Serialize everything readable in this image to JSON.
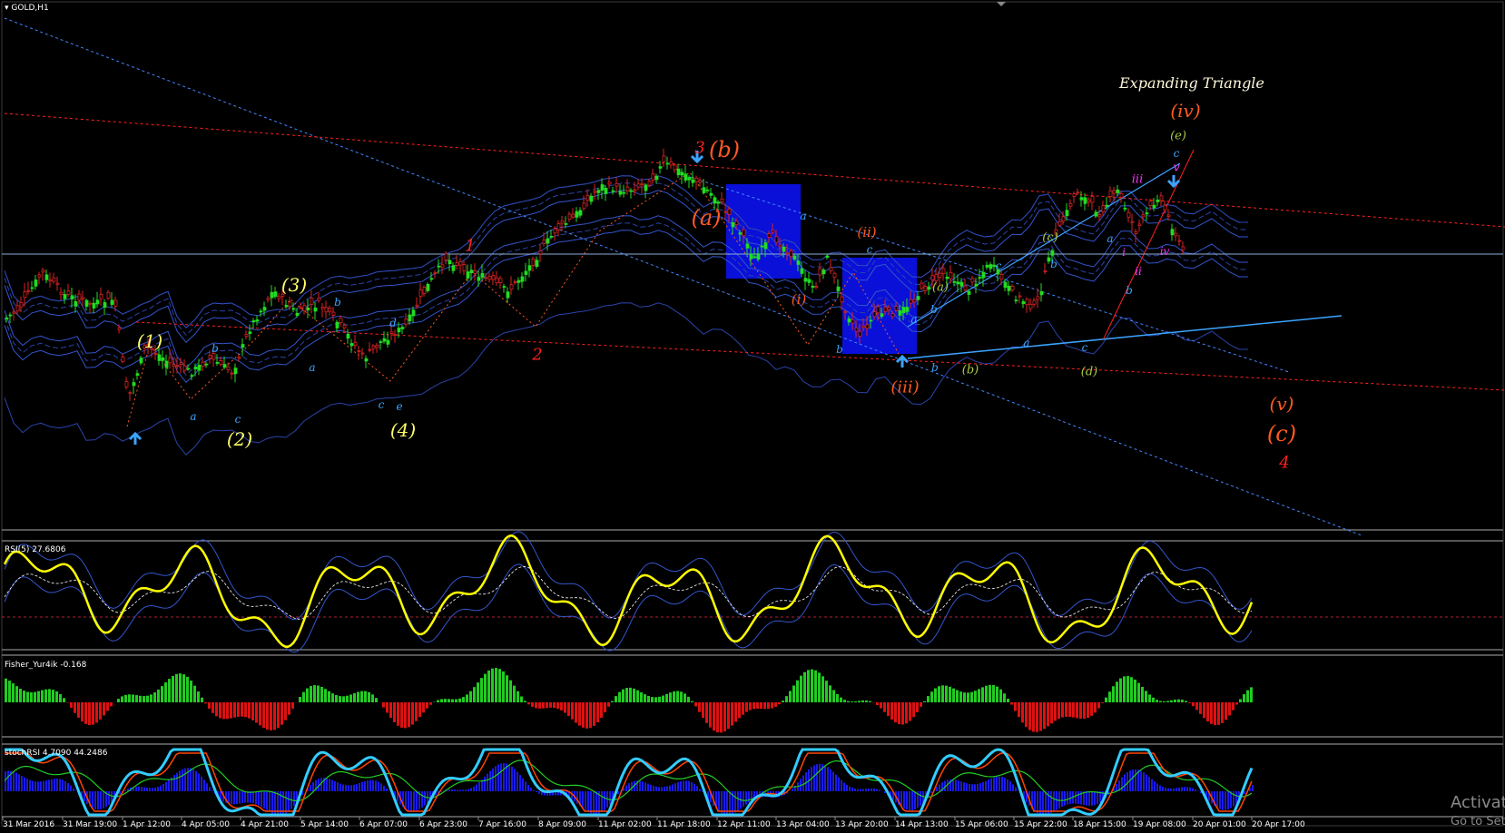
{
  "chart_data": [
    {
      "panel": "price",
      "type": "candlestick",
      "label": "GOLD,H1",
      "annotation_title": "Expanding Triangle",
      "x_labels": [
        "31 Mar 2016",
        "31 Mar 19:00",
        "1 Apr 12:00",
        "4 Apr 05:00",
        "4 Apr 21:00",
        "5 Apr 14:00",
        "6 Apr 07:00",
        "6 Apr 23:00",
        "7 Apr 16:00",
        "8 Apr 09:00",
        "11 Apr 02:00",
        "11 Apr 18:00",
        "12 Apr 11:00",
        "13 Apr 04:00",
        "13 Apr 20:00",
        "14 Apr 13:00",
        "15 Apr 06:00",
        "15 Apr 22:00",
        "18 Apr 15:00",
        "19 Apr 08:00",
        "20 Apr 01:00",
        "20 Apr 17:00"
      ],
      "close_path": [
        [
          0,
          355
        ],
        [
          20,
          340
        ],
        [
          45,
          300
        ],
        [
          70,
          325
        ],
        [
          100,
          335
        ],
        [
          125,
          330
        ],
        [
          140,
          440
        ],
        [
          160,
          380
        ],
        [
          185,
          400
        ],
        [
          210,
          410
        ],
        [
          230,
          395
        ],
        [
          255,
          410
        ],
        [
          275,
          360
        ],
        [
          300,
          320
        ],
        [
          325,
          345
        ],
        [
          350,
          335
        ],
        [
          375,
          360
        ],
        [
          400,
          395
        ],
        [
          420,
          375
        ],
        [
          445,
          360
        ],
        [
          470,
          315
        ],
        [
          490,
          285
        ],
        [
          520,
          300
        ],
        [
          560,
          320
        ],
        [
          585,
          290
        ],
        [
          610,
          255
        ],
        [
          630,
          240
        ],
        [
          660,
          205
        ],
        [
          690,
          210
        ],
        [
          715,
          200
        ],
        [
          730,
          180
        ],
        [
          760,
          195
        ],
        [
          790,
          220
        ],
        [
          815,
          255
        ],
        [
          830,
          285
        ],
        [
          850,
          260
        ],
        [
          875,
          285
        ],
        [
          895,
          320
        ],
        [
          910,
          285
        ],
        [
          930,
          340
        ],
        [
          945,
          370
        ],
        [
          965,
          345
        ],
        [
          990,
          345
        ],
        [
          1015,
          320
        ],
        [
          1040,
          300
        ],
        [
          1065,
          320
        ],
        [
          1090,
          290
        ],
        [
          1115,
          325
        ],
        [
          1140,
          340
        ],
        [
          1160,
          265
        ],
        [
          1185,
          210
        ],
        [
          1210,
          235
        ],
        [
          1230,
          210
        ],
        [
          1250,
          255
        ],
        [
          1275,
          215
        ],
        [
          1295,
          260
        ],
        [
          1300,
          275
        ]
      ],
      "elliott_labels": [
        {
          "t": "(1)",
          "c": "#ffff66"
        },
        {
          "t": "(2)",
          "c": "#ffff66"
        },
        {
          "t": "(3)",
          "c": "#ffff66"
        },
        {
          "t": "(4)",
          "c": "#ffff66"
        },
        {
          "t": "a",
          "c": "#3ba4ff"
        },
        {
          "t": "b",
          "c": "#3ba4ff"
        },
        {
          "t": "c",
          "c": "#3ba4ff"
        },
        {
          "t": "a",
          "c": "#3ba4ff"
        },
        {
          "t": "b",
          "c": "#3ba4ff"
        },
        {
          "t": "d",
          "c": "#3ba4ff"
        },
        {
          "t": "c",
          "c": "#3ba4ff"
        },
        {
          "t": "e",
          "c": "#3ba4ff"
        },
        {
          "t": "1",
          "c": "#ff2020"
        },
        {
          "t": "2",
          "c": "#ff2020"
        },
        {
          "t": "3",
          "c": "#ff2020"
        },
        {
          "t": "4",
          "c": "#ff2020"
        },
        {
          "t": "(b)",
          "c": "#ff5a20"
        },
        {
          "t": "(a)",
          "c": "#ff5a20"
        },
        {
          "t": "(c)",
          "c": "#ff5a20"
        },
        {
          "t": "(v)",
          "c": "#ff5a20"
        },
        {
          "t": "(iv)",
          "c": "#ff5a20"
        },
        {
          "t": "(iii)",
          "c": "#ff5a20"
        },
        {
          "t": "(ii)",
          "c": "#ff5a20"
        },
        {
          "t": "(i)",
          "c": "#ff5a20"
        },
        {
          "t": "a",
          "c": "#3ba4ff"
        },
        {
          "t": "b",
          "c": "#3ba4ff"
        },
        {
          "t": "c",
          "c": "#3ba4ff"
        },
        {
          "t": "b",
          "c": "#3ba4ff"
        },
        {
          "t": "a",
          "c": "#3ba4ff"
        },
        {
          "t": "b",
          "c": "#3ba4ff"
        },
        {
          "t": "c",
          "c": "#3ba4ff"
        },
        {
          "t": "a",
          "c": "#3ba4ff"
        },
        {
          "t": "b",
          "c": "#3ba4ff"
        },
        {
          "t": "c",
          "c": "#3ba4ff"
        },
        {
          "t": "a",
          "c": "#3ba4ff"
        },
        {
          "t": "b",
          "c": "#3ba4ff"
        },
        {
          "t": "c",
          "c": "#3ba4ff"
        },
        {
          "t": "(a)",
          "c": "#aacc44"
        },
        {
          "t": "(b)",
          "c": "#aacc44"
        },
        {
          "t": "(c)",
          "c": "#aacc44"
        },
        {
          "t": "(d)",
          "c": "#aacc44"
        },
        {
          "t": "(e)",
          "c": "#aacc44"
        },
        {
          "t": "i",
          "c": "#ff33ff"
        },
        {
          "t": "ii",
          "c": "#ff33ff"
        },
        {
          "t": "iii",
          "c": "#ff33ff"
        },
        {
          "t": "iv",
          "c": "#ff33ff"
        },
        {
          "t": "v",
          "c": "#ff33ff"
        }
      ]
    },
    {
      "panel": "rsi",
      "type": "line",
      "label": "RSI(5) 27.6806",
      "series": [
        {
          "color": "#ffff00"
        }
      ]
    },
    {
      "panel": "fisher",
      "type": "bar",
      "label": "Fisher_Yur4ik -0.168",
      "up_color": "#22cc22",
      "down_color": "#dd1111"
    },
    {
      "panel": "stochrsi",
      "type": "line",
      "label": "stochRSI 4.7090 44.2486",
      "series": [
        {
          "color": "#33ccff"
        },
        {
          "color": "#ff4400"
        },
        {
          "color": "#22cc22"
        }
      ]
    }
  ],
  "watermark": {
    "line1": "Activat",
    "line2": "Go to Set"
  }
}
